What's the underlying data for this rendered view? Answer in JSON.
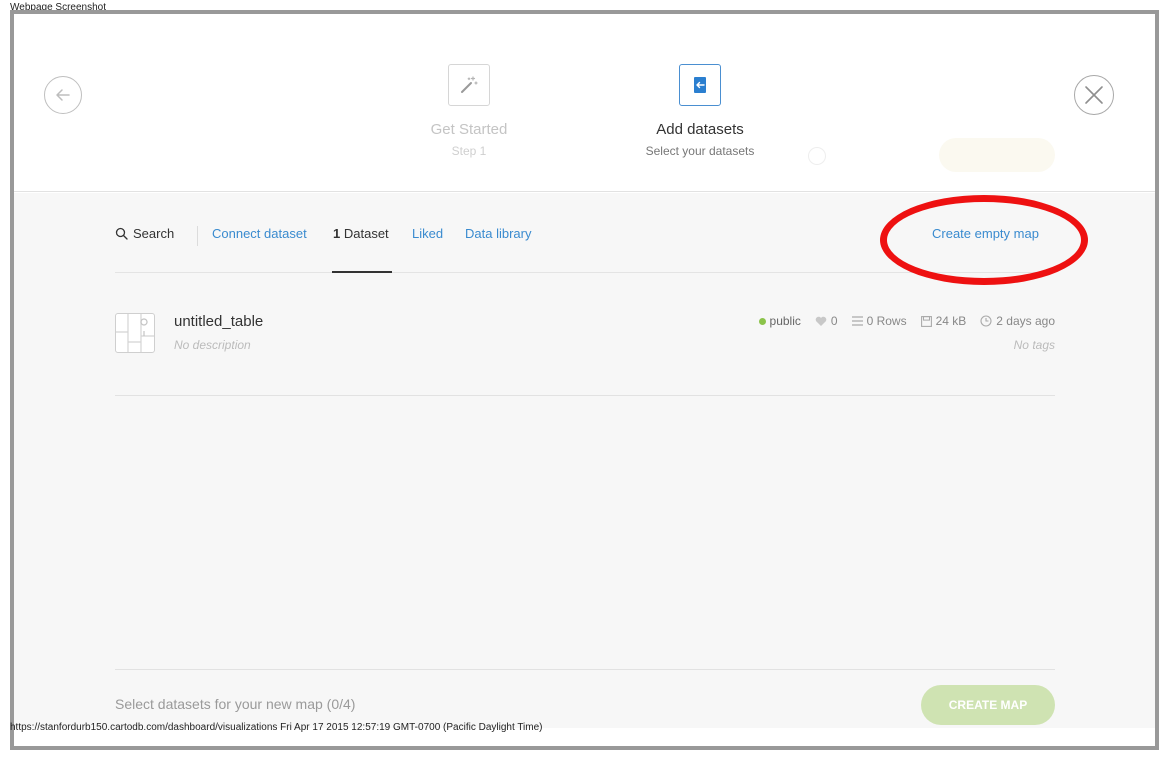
{
  "captions": {
    "top": "Webpage Screenshot",
    "bottom": "https://stanfordurb150.cartodb.com/dashboard/visualizations Fri Apr 17 2015 12:57:19 GMT-0700 (Pacific Daylight Time)"
  },
  "header": {
    "steps": [
      {
        "title": "Get Started",
        "sub": "Step 1",
        "icon": "magic-wand-icon"
      },
      {
        "title": "Add datasets",
        "sub": "Select your datasets",
        "icon": "import-icon"
      }
    ]
  },
  "tabs": {
    "search": "Search",
    "connect": "Connect dataset",
    "dataset_count": "1",
    "dataset_label": "Dataset",
    "liked": "Liked",
    "library": "Data library",
    "create_empty": "Create empty map"
  },
  "dataset": {
    "name": "untitled_table",
    "description": "No description",
    "privacy": "public",
    "likes": "0",
    "rows": "0 Rows",
    "size": "24 kB",
    "updated": "2 days ago",
    "tags": "No tags"
  },
  "footer": {
    "selection_text": "Select datasets for your new map (0/4)",
    "create_button": "CREATE MAP"
  },
  "colors": {
    "accent_link": "#3a8bcf",
    "public_dot": "#8bc34a",
    "create_button_bg": "#cfe3b2",
    "annotation": "#ee1111"
  }
}
